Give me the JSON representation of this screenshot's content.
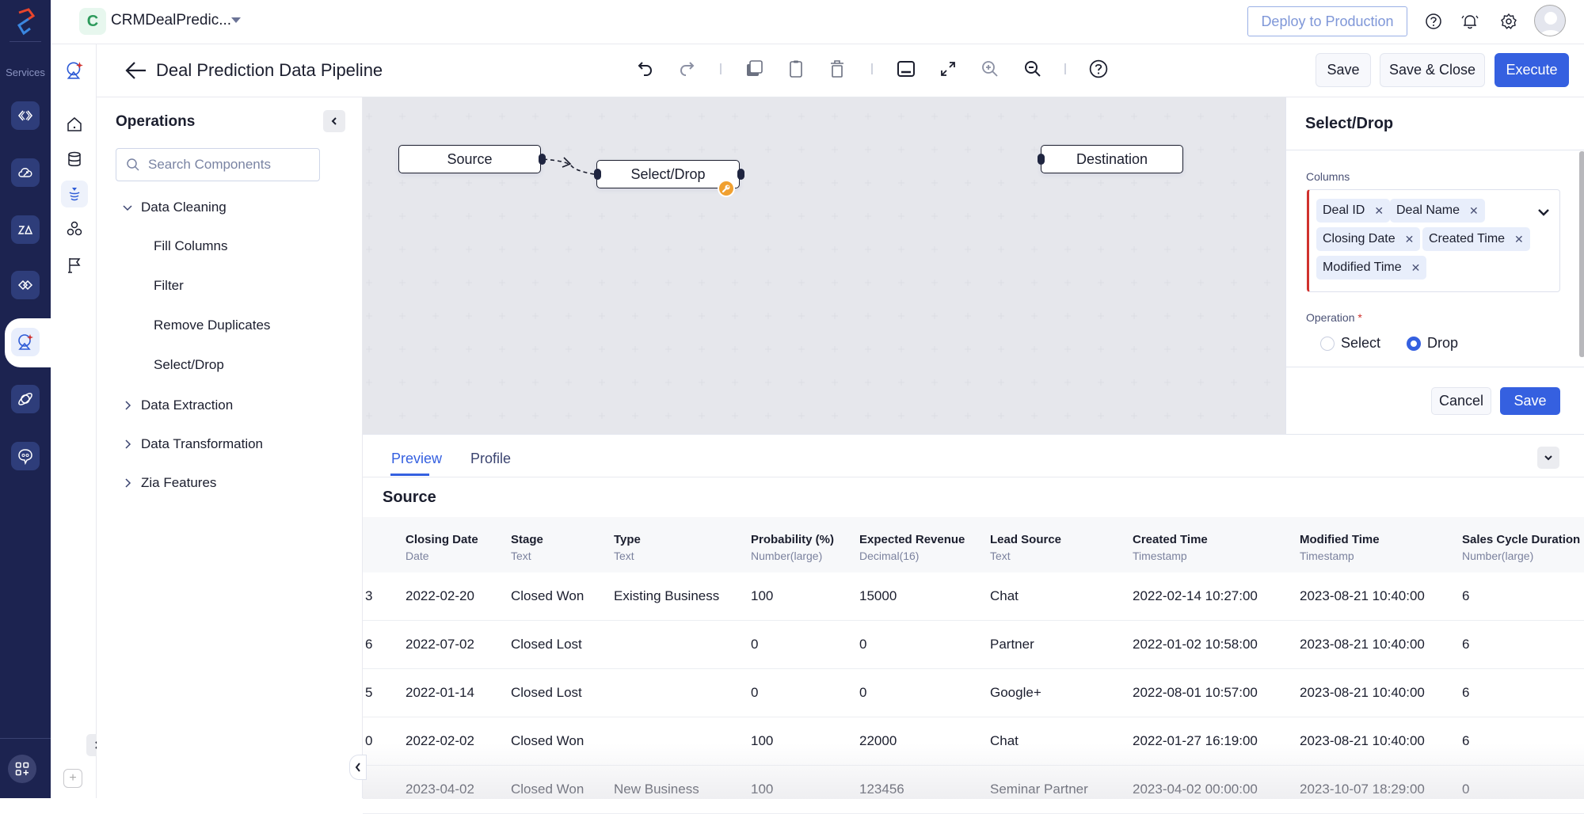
{
  "rail": {
    "services_label": "Services",
    "items": [
      {
        "icon": "code-brackets-icon"
      },
      {
        "icon": "cloud-sync-icon"
      },
      {
        "icon": "zia-icon"
      },
      {
        "icon": "integration-icon"
      },
      {
        "icon": "data-pipeline-icon",
        "active": true
      },
      {
        "icon": "planet-icon"
      },
      {
        "icon": "chat-bot-icon"
      }
    ],
    "apps_icon": "apps-grid-add-icon"
  },
  "topbar": {
    "project_initial": "C",
    "project_name": "CRMDealPredic...",
    "deploy_label": "Deploy to Production",
    "icons": [
      "help-icon",
      "notification-bell-icon",
      "settings-gear-icon",
      "user-avatar"
    ]
  },
  "nav2": {
    "items": [
      "pipeline-logo-icon",
      "home-icon",
      "database-icon",
      "pipeline-icon",
      "components-icon",
      "flag-icon"
    ],
    "selected": "pipeline-icon"
  },
  "header": {
    "title": "Deal Prediction Data Pipeline",
    "toolbar": [
      "undo",
      "redo",
      "copy",
      "paste",
      "delete",
      "toggle-panel",
      "fit-screen",
      "zoom-in",
      "zoom-out",
      "help"
    ],
    "save_label": "Save",
    "save_close_label": "Save & Close",
    "execute_label": "Execute"
  },
  "operations": {
    "title": "Operations",
    "search_placeholder": "Search Components",
    "categories": [
      {
        "label": "Data Cleaning",
        "expanded": true,
        "items": [
          "Fill Columns",
          "Filter",
          "Remove Duplicates",
          "Select/Drop"
        ]
      },
      {
        "label": "Data Extraction",
        "expanded": false
      },
      {
        "label": "Data Transformation",
        "expanded": false
      },
      {
        "label": "Zia Features",
        "expanded": false
      }
    ]
  },
  "canvas": {
    "nodes": [
      {
        "label": "Source"
      },
      {
        "label": "Select/Drop",
        "badge": "wrench-icon"
      },
      {
        "label": "Destination"
      }
    ]
  },
  "panel": {
    "title": "Select/Drop",
    "columns_label": "Columns",
    "columns": [
      "Deal ID",
      "Deal Name",
      "Closing Date",
      "Created Time",
      "Modified Time"
    ],
    "operation_label": "Operation",
    "required_mark": "*",
    "options": [
      "Select",
      "Drop"
    ],
    "selected_option": "Drop",
    "cancel_label": "Cancel",
    "save_label": "Save"
  },
  "preview": {
    "tabs": [
      "Preview",
      "Profile"
    ],
    "active_tab": "Preview",
    "section_title": "Source",
    "columns": [
      {
        "name": "Closing Date",
        "type": "Date"
      },
      {
        "name": "Stage",
        "type": "Text"
      },
      {
        "name": "Type",
        "type": "Text"
      },
      {
        "name": "Probability (%)",
        "type": "Number(large)"
      },
      {
        "name": "Expected Revenue",
        "type": "Decimal(16)"
      },
      {
        "name": "Lead Source",
        "type": "Text"
      },
      {
        "name": "Created Time",
        "type": "Timestamp"
      },
      {
        "name": "Modified Time",
        "type": "Timestamp"
      },
      {
        "name": "Sales Cycle Duration",
        "type": "Number(large)"
      }
    ],
    "rows": [
      {
        "cut": "3",
        "cells": [
          "2022-02-20",
          "Closed Won",
          "Existing Business",
          "100",
          "15000",
          "Chat",
          "2022-02-14 10:27:00",
          "2023-08-21 10:40:00",
          "6"
        ]
      },
      {
        "cut": "6",
        "cells": [
          "2022-07-02",
          "Closed Lost",
          "",
          "0",
          "0",
          "Partner",
          "2022-01-02 10:58:00",
          "2023-08-21 10:40:00",
          "6"
        ]
      },
      {
        "cut": "5",
        "cells": [
          "2022-01-14",
          "Closed Lost",
          "",
          "0",
          "0",
          "Google+",
          "2022-08-01 10:57:00",
          "2023-08-21 10:40:00",
          "6"
        ]
      },
      {
        "cut": "0",
        "cells": [
          "2022-02-02",
          "Closed Won",
          "",
          "100",
          "22000",
          "Chat",
          "2022-01-27 16:19:00",
          "2023-08-21 10:40:00",
          "6"
        ]
      },
      {
        "cut": "",
        "cells": [
          "2023-04-02",
          "Closed Won",
          "New Business",
          "100",
          "123456",
          "Seminar Partner",
          "2023-04-02 00:00:00",
          "2023-10-07 18:29:00",
          "0"
        ]
      }
    ]
  },
  "colors": {
    "rail_bg": "#1c2350",
    "accent": "#3560e0",
    "required": "#d0312d",
    "node_badge": "#f0a030",
    "tag_bg": "#e8eefb"
  }
}
